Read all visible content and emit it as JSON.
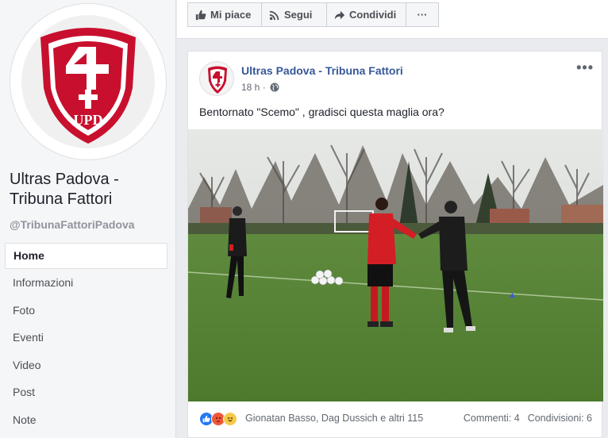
{
  "sidebar": {
    "page_name": "Ultras Padova - Tribuna Fattori",
    "handle": "@TribunaFattoriPadova",
    "logo_text": "UPD",
    "items": [
      {
        "label": "Home"
      },
      {
        "label": "Informazioni"
      },
      {
        "label": "Foto"
      },
      {
        "label": "Eventi"
      },
      {
        "label": "Video"
      },
      {
        "label": "Post"
      },
      {
        "label": "Note"
      }
    ]
  },
  "actions": {
    "like": "Mi piace",
    "follow": "Segui",
    "share": "Condividi",
    "more": "···"
  },
  "post": {
    "author": "Ultras Padova - Tribuna Fattori",
    "time": "18 h ·",
    "text": "Bentornato \"Scemo\" , gradisci questa maglia ora?",
    "more": "•••",
    "likers": "Gionatan Basso, Dag Dussich e altri 115",
    "comments": "Commenti: 4",
    "shares": "Condivisioni: 6",
    "photo_description": "football training field with players"
  },
  "colors": {
    "brand_blue": "#365899",
    "logo_red": "#c8102e"
  }
}
